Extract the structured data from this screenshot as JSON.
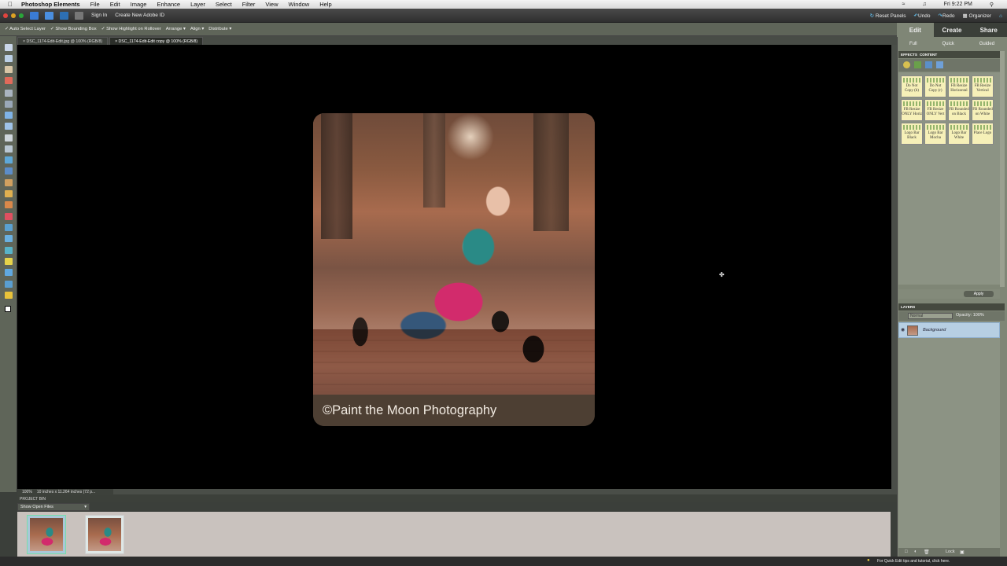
{
  "mac_menubar": {
    "app_name": "Photoshop Elements",
    "menus": [
      "File",
      "Edit",
      "Image",
      "Enhance",
      "Layer",
      "Select",
      "Filter",
      "View",
      "Window",
      "Help"
    ],
    "clock": "Fri 9:22 PM"
  },
  "app_bar": {
    "sign_in": "Sign In",
    "create_id": "Create New Adobe ID",
    "reset_panels": "Reset Panels",
    "undo": "Undo",
    "redo": "Redo",
    "organizer": "Organizer"
  },
  "options_bar": {
    "auto_select": "Auto Select Layer",
    "show_bounding": "Show Bounding Box",
    "show_highlight": "Show Highlight on Rollover",
    "arrange": "Arrange",
    "align": "Align",
    "distribute": "Distribute"
  },
  "doc_tabs": [
    {
      "label": "DSC_1174-Edit-Edit.jpg @ 100% (RGB/8)",
      "active": false
    },
    {
      "label": "DSC_1174-Edit-Edit copy @ 100% (RGB/8)",
      "active": true
    }
  ],
  "canvas": {
    "caption": "©Paint the Moon Photography"
  },
  "status": {
    "zoom": "100%",
    "doc_size": "10 inches x 11.264 inches (72 p..."
  },
  "project_bin": {
    "header": "PROJECT BIN",
    "filter": "Show Open Files"
  },
  "right_panel": {
    "mode_tabs": [
      "Edit",
      "Create",
      "Share"
    ],
    "sub_tabs": [
      "Full",
      "Quick",
      "Guided"
    ],
    "effects_tabs": [
      "EFFECTS",
      "CONTENT"
    ],
    "effects": [
      "Do Not Copy (b)",
      "Do Not Copy (r)",
      "FB Resize Horizontal",
      "FB Resize Vertical",
      "FB Resize ONLY Horiz",
      "FB Resize ONLY Vert",
      "FB Rounded on Black",
      "FB Rounded on White",
      "Logo Bar Black",
      "Logo Bar Mocha",
      "Logo Bar White",
      "Place Logo"
    ],
    "apply": "Apply",
    "layers_header": "LAYERS",
    "blend_mode": "Normal",
    "opacity_label": "Opacity:",
    "opacity_value": "100%",
    "layer_name": "Background",
    "lock": "Lock"
  },
  "footer": {
    "tip": "For Quick Edit tips and tutorial, click here."
  }
}
